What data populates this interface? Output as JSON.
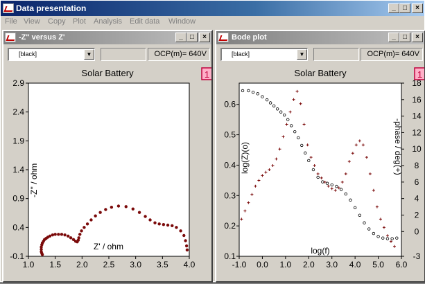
{
  "app": {
    "title": "Data presentation"
  },
  "window_controls": {
    "minimize": "_",
    "maximize": "□",
    "close": "×"
  },
  "menu": [
    "File",
    "View",
    "Copy",
    "Plot",
    "Analysis",
    "Edit data",
    "Window"
  ],
  "windows": [
    {
      "title": "-Z'' versus Z'",
      "selector_value": "[black]",
      "ocp_text": "OCP(m)= 640V",
      "badge": "1",
      "chart_title": "Solar Battery"
    },
    {
      "title": "Bode plot",
      "selector_value": "[black]",
      "ocp_text": "OCP(m)= 640V",
      "badge": "1",
      "chart_title": "Solar Battery"
    }
  ],
  "colors": {
    "series": "#7b0a0a",
    "badge_border": "#c0003c",
    "badge_fill": "#ffb0c8"
  },
  "chart_data": [
    {
      "type": "scatter",
      "title": "Solar Battery",
      "xlabel": "Z' / ohm",
      "ylabel": "-Z'' / ohm",
      "xlim": [
        1.0,
        4.0
      ],
      "ylim": [
        -0.1,
        2.9
      ],
      "xticks": [
        "1.0",
        "1.5",
        "2.0",
        "2.5",
        "3.0",
        "3.5",
        "4.0"
      ],
      "yticks": [
        "-0.1",
        "0.4",
        "0.9",
        "1.4",
        "1.9",
        "2.4",
        "2.9"
      ],
      "marker": "filled-circle",
      "series": [
        {
          "x": [
            1.26,
            1.25,
            1.24,
            1.24,
            1.24,
            1.25,
            1.26,
            1.28,
            1.3,
            1.33,
            1.36,
            1.4,
            1.45,
            1.5,
            1.56,
            1.62,
            1.68,
            1.74,
            1.79,
            1.84,
            1.88,
            1.91,
            1.93,
            1.94,
            1.96,
            1.99,
            2.04,
            2.1,
            2.17,
            2.25,
            2.34,
            2.44,
            2.55,
            2.68,
            2.82,
            2.95,
            3.07,
            3.18,
            3.27,
            3.36,
            3.44,
            3.52,
            3.6,
            3.68,
            3.76,
            3.84,
            3.9,
            3.93,
            3.95,
            3.96
          ],
          "y": [
            -0.07,
            -0.05,
            -0.02,
            0.02,
            0.06,
            0.1,
            0.13,
            0.16,
            0.19,
            0.21,
            0.23,
            0.25,
            0.27,
            0.28,
            0.28,
            0.28,
            0.27,
            0.25,
            0.22,
            0.19,
            0.16,
            0.15,
            0.18,
            0.22,
            0.28,
            0.34,
            0.4,
            0.46,
            0.53,
            0.6,
            0.66,
            0.71,
            0.75,
            0.77,
            0.76,
            0.72,
            0.66,
            0.59,
            0.53,
            0.48,
            0.46,
            0.45,
            0.44,
            0.43,
            0.4,
            0.34,
            0.26,
            0.17,
            0.08,
            0.01
          ]
        }
      ]
    },
    {
      "type": "scatter",
      "title": "Solar Battery",
      "xlabel": "log(f)",
      "ylabel": "log(Z)(o)",
      "y2label": "-phase / deg(+)",
      "xlim": [
        -1.0,
        6.0
      ],
      "ylim": [
        0.1,
        0.67
      ],
      "y2lim": [
        -3,
        18
      ],
      "xticks": [
        "-1.0",
        "0.0",
        "1.0",
        "2.0",
        "3.0",
        "4.0",
        "5.0",
        "6.0"
      ],
      "yticks": [
        "0.1",
        "0.2",
        "0.3",
        "0.4",
        "0.5",
        "0.6"
      ],
      "y2ticks": [
        "-3",
        "0",
        "2",
        "4",
        "6",
        "8",
        "10",
        "12",
        "14",
        "16",
        "18"
      ],
      "series": [
        {
          "marker": "open-circle",
          "axis": "left",
          "x": [
            -0.85,
            -0.6,
            -0.4,
            -0.2,
            0.0,
            0.2,
            0.35,
            0.5,
            0.65,
            0.8,
            0.95,
            1.1,
            1.25,
            1.4,
            1.55,
            1.7,
            1.85,
            2.0,
            2.2,
            2.4,
            2.6,
            2.8,
            3.0,
            3.2,
            3.4,
            3.6,
            3.8,
            4.0,
            4.2,
            4.4,
            4.6,
            4.8,
            5.0,
            5.2,
            5.4,
            5.6,
            5.8
          ],
          "y": [
            0.645,
            0.645,
            0.64,
            0.635,
            0.625,
            0.615,
            0.605,
            0.595,
            0.585,
            0.575,
            0.565,
            0.55,
            0.53,
            0.51,
            0.49,
            0.465,
            0.44,
            0.415,
            0.385,
            0.36,
            0.345,
            0.34,
            0.335,
            0.33,
            0.32,
            0.305,
            0.285,
            0.26,
            0.235,
            0.21,
            0.19,
            0.175,
            0.165,
            0.16,
            0.158,
            0.158,
            0.16
          ]
        },
        {
          "marker": "plus",
          "axis": "right",
          "x": [
            -0.9,
            -0.75,
            -0.6,
            -0.45,
            -0.3,
            -0.15,
            0.0,
            0.15,
            0.3,
            0.45,
            0.6,
            0.75,
            0.9,
            1.05,
            1.2,
            1.35,
            1.5,
            1.65,
            1.8,
            1.95,
            2.1,
            2.25,
            2.4,
            2.55,
            2.7,
            2.85,
            3.0,
            3.15,
            3.3,
            3.45,
            3.6,
            3.75,
            3.9,
            4.05,
            4.2,
            4.35,
            4.5,
            4.65,
            4.8,
            4.95,
            5.1,
            5.25,
            5.4,
            5.55,
            5.7
          ],
          "y": [
            1.5,
            2.5,
            3.5,
            4.5,
            5.5,
            6.2,
            6.8,
            7.2,
            7.5,
            8.0,
            8.8,
            10.0,
            11.5,
            13.0,
            14.5,
            16.0,
            17.0,
            15.5,
            13.0,
            10.5,
            9.0,
            8.0,
            7.0,
            6.5,
            6.0,
            5.5,
            5.2,
            5.0,
            5.3,
            6.0,
            7.0,
            8.5,
            9.5,
            10.5,
            11.0,
            10.5,
            9.0,
            7.0,
            5.0,
            3.0,
            1.5,
            0.5,
            -0.5,
            -1.2,
            -1.8
          ]
        }
      ]
    }
  ]
}
